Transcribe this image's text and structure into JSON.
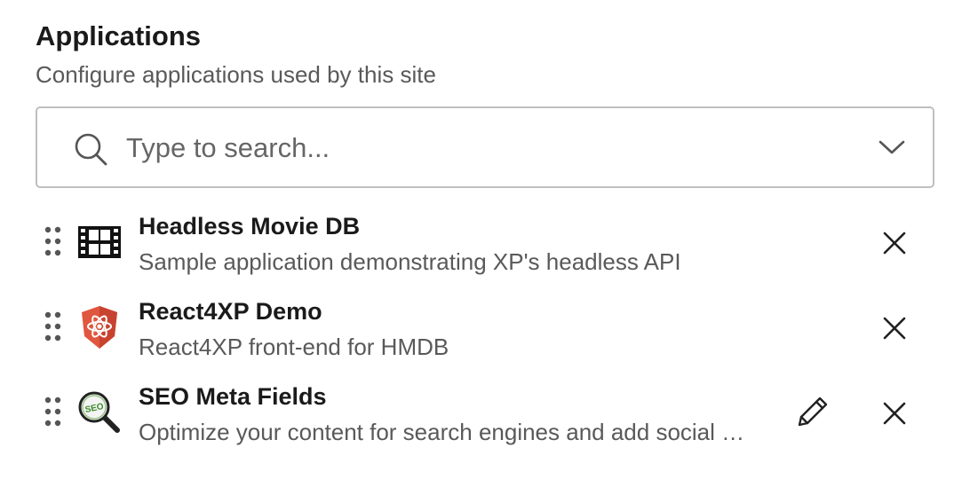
{
  "section": {
    "title": "Applications",
    "subtitle": "Configure applications used by this site"
  },
  "search": {
    "placeholder": "Type to search...",
    "value": ""
  },
  "applications": [
    {
      "name": "Headless Movie DB",
      "description": "Sample application demonstrating XP's headless API",
      "icon": "film-strip-icon",
      "editable": false
    },
    {
      "name": "React4XP Demo",
      "description": "React4XP front-end for HMDB",
      "icon": "react-shield-icon",
      "editable": false
    },
    {
      "name": "SEO Meta Fields",
      "description": "Optimize your content for search engines and add social media metadata",
      "icon": "seo-magnifier-icon",
      "editable": true
    }
  ],
  "colors": {
    "text_primary": "#1a1a1a",
    "text_secondary": "#595959",
    "border": "#bfbfbf",
    "react_shield": "#e0573f",
    "seo_green": "#3a8a2a"
  },
  "seo_icon_label": "SEO"
}
